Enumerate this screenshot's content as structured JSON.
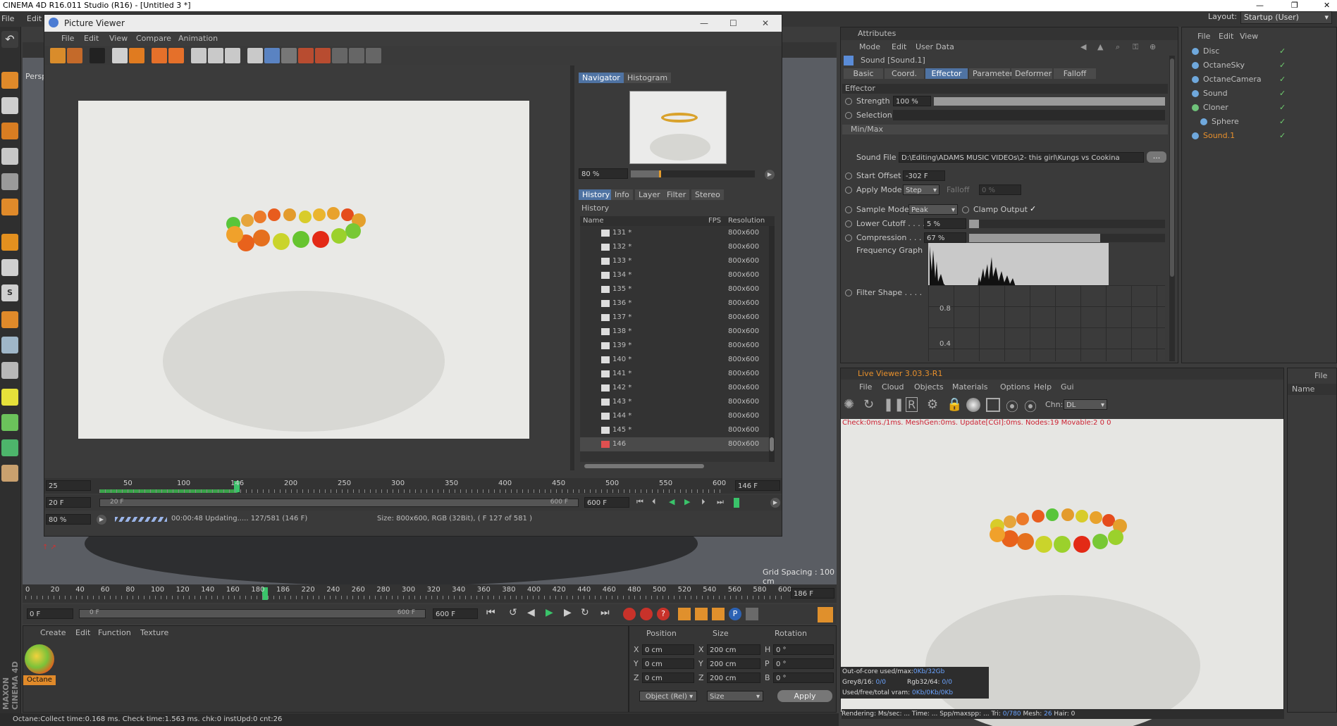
{
  "app_title": "CINEMA 4D R16.011 Studio (R16) - [Untitled 3 *]",
  "main_menu": [
    "File",
    "Edit"
  ],
  "layout": {
    "label": "Layout:",
    "value": "Startup (User)"
  },
  "viewport": {
    "label": "Persp",
    "grid_spacing": "Grid Spacing : 100 cm"
  },
  "picture_viewer": {
    "title": "Picture Viewer",
    "menu": [
      "File",
      "Edit",
      "View",
      "Compare",
      "Animation"
    ],
    "nav_tabs": [
      "Navigator",
      "Histogram"
    ],
    "nav_zoom": "80 %",
    "info_tabs": [
      "History",
      "Info",
      "Layer",
      "Filter",
      "Stereo"
    ],
    "history_title": "History",
    "history_cols": [
      "Name",
      "FPS",
      "Resolution"
    ],
    "history_rows": [
      {
        "name": "131 *",
        "res": "800x600"
      },
      {
        "name": "132 *",
        "res": "800x600"
      },
      {
        "name": "133 *",
        "res": "800x600"
      },
      {
        "name": "134 *",
        "res": "800x600"
      },
      {
        "name": "135 *",
        "res": "800x600"
      },
      {
        "name": "136 *",
        "res": "800x600"
      },
      {
        "name": "137 *",
        "res": "800x600"
      },
      {
        "name": "138 *",
        "res": "800x600"
      },
      {
        "name": "139 *",
        "res": "800x600"
      },
      {
        "name": "140 *",
        "res": "800x600"
      },
      {
        "name": "141 *",
        "res": "800x600"
      },
      {
        "name": "142 *",
        "res": "800x600"
      },
      {
        "name": "143 *",
        "res": "800x600"
      },
      {
        "name": "144 *",
        "res": "800x600"
      },
      {
        "name": "145 *",
        "res": "800x600"
      },
      {
        "name": "146",
        "res": "800x600"
      }
    ],
    "timeline": {
      "start_field": "25",
      "ticks": [
        "50",
        "100",
        "146",
        "200",
        "250",
        "300",
        "350",
        "400",
        "450",
        "500",
        "550",
        "600"
      ],
      "end_field": "146 F",
      "range_start": "20 F",
      "range_left": "20 F",
      "range_right": "600 F",
      "range_end": "600 F"
    },
    "zoom": "80 %",
    "progress_status": "00:00:48  Updating..... 127/581 (146 F)",
    "size_status": "Size: 800x600, RGB (32Bit),  ( F 127 of 581 )"
  },
  "attributes": {
    "title": "Attributes",
    "menu": [
      "Mode",
      "Edit",
      "User Data"
    ],
    "object": "Sound [Sound.1]",
    "tabs": [
      "Basic",
      "Coord.",
      "Effector",
      "Parameter",
      "Deformer",
      "Falloff"
    ],
    "section": "Effector",
    "strength_label": "Strength",
    "strength_value": "100 %",
    "strength_fraction": 1.0,
    "selection_label": "Selection",
    "minmax_label": "Min/Max",
    "sound_file_label": "Sound File",
    "sound_file_value": "D:\\Editing\\ADAMS MUSIC VIDEOs\\2- this girl\\Kungs vs Cookina",
    "sound_file_btn": "...",
    "start_offset_label": "Start Offset",
    "start_offset_value": "-302 F",
    "apply_mode_label": "Apply Mode",
    "apply_mode_value": "Step",
    "falloff_label": "Falloff",
    "falloff_value": "0 %",
    "sample_mode_label": "Sample Mode",
    "sample_mode_value": "Peak",
    "clamp_output_label": "Clamp Output",
    "clamp_output_check": "✓",
    "lower_cutoff_label": "Lower Cutoff . . . .",
    "lower_cutoff_value": "5 %",
    "lower_cutoff_fraction": 0.05,
    "compression_label": "Compression . . . .",
    "compression_value": "67 %",
    "compression_fraction": 0.67,
    "freq_graph_label": "Frequency Graph",
    "filter_shape_label": "Filter Shape . . . .",
    "filter_y1": "0.8",
    "filter_y2": "0.4"
  },
  "objects": {
    "menu": [
      "File",
      "Edit",
      "View"
    ],
    "items": [
      "Disc",
      "OctaneSky",
      "OctaneCamera",
      "Sound",
      "Cloner",
      "Sphere",
      "Sound.1"
    ]
  },
  "live_viewer": {
    "title": "Live Viewer 3.03.3-R1",
    "menu": [
      "File",
      "Cloud",
      "Objects",
      "Materials",
      "Options",
      "Help",
      "Gui"
    ],
    "chn_label": "Chn:",
    "chn_value": "DL",
    "status_top": "Check:0ms./1ms. MeshGen:0ms. Update[CGI]:0ms. Nodes:19 Movable:2  0 0",
    "out_of_core": "Out-of-core used/max:",
    "out_of_core_val": "0Kb/32Gb",
    "grey": "Grey8/16: ",
    "grey_val": "0/0",
    "rgb": "Rgb32/64: ",
    "rgb_val": "0/0",
    "vram": "Used/free/total vram: ",
    "vram_val": "0Kb/0Kb/0Kb",
    "rendering": "Rendering:      Ms/sec: ...   Time: ...        Spp/maxspp: ...      Tri: ",
    "tri_val": "0/780",
    "mesh_label": "   Mesh: ",
    "mesh_val": "26",
    "hair_label": "   Hair: ",
    "hair_val": "0"
  },
  "right_small": {
    "menu": [
      "File"
    ],
    "header": "Name"
  },
  "main_timeline": {
    "ticks": [
      "0",
      "20",
      "40",
      "60",
      "80",
      "100",
      "120",
      "140",
      "160",
      "180",
      "186",
      "220",
      "240",
      "260",
      "280",
      "300",
      "320",
      "340",
      "360",
      "380",
      "400",
      "420",
      "440",
      "460",
      "480",
      "500",
      "520",
      "540",
      "560",
      "580",
      "600"
    ],
    "end_field": "186 F",
    "start": "0 F",
    "range_left": "0 F",
    "range_right": "600 F",
    "range_end": "600 F"
  },
  "materials": {
    "menu": [
      "Create",
      "Edit",
      "Function",
      "Texture"
    ],
    "material_name": "Octane"
  },
  "coords": {
    "headers": [
      "Position",
      "Size",
      "Rotation"
    ],
    "rows": [
      {
        "axis": "X",
        "pos": "0 cm",
        "saxis": "X",
        "size": "200 cm",
        "raxis": "H",
        "rot": "0 °"
      },
      {
        "axis": "Y",
        "pos": "0 cm",
        "saxis": "Y",
        "size": "200 cm",
        "raxis": "P",
        "rot": "0 °"
      },
      {
        "axis": "Z",
        "pos": "0 cm",
        "saxis": "Z",
        "size": "200 cm",
        "raxis": "B",
        "rot": "0 °"
      }
    ],
    "mode": "Object (Rel)",
    "size_mode": "Size",
    "apply": "Apply"
  },
  "status_bar": "Octane:Collect time:0.168 ms.  Check time:1.563 ms.  chk:0  instUpd:0  cnt:26",
  "brand": "MAXON CINEMA 4D"
}
